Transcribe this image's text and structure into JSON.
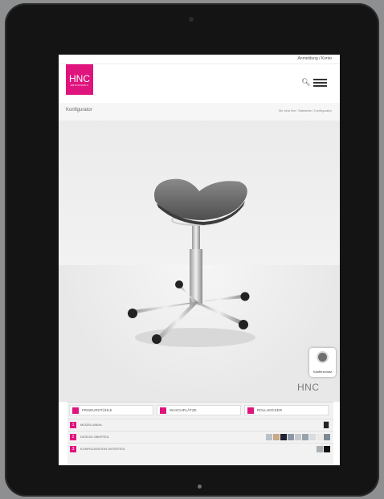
{
  "header": {
    "account_link": "Anmeldung / Konto",
    "logo_text": "HNC",
    "logo_subtext": "ERGONOMIC"
  },
  "subheader": {
    "page_title": "Konfigurator",
    "breadcrumb": "Sie sind hier: Startseite / Konfigurator"
  },
  "stage": {
    "badge_label": "Käuferschutz",
    "watermark_logo": "HNC"
  },
  "config": {
    "categories": [
      {
        "label": "FRISEURSTÜHLE"
      },
      {
        "label": "WASCHPLÄTZE"
      },
      {
        "label": "ROLLHOCKER"
      }
    ],
    "steps": [
      {
        "number": "1",
        "label": "MODELLWAHL"
      },
      {
        "number": "2",
        "label": "DESIGN OBERTEIL"
      },
      {
        "number": "3",
        "label": "KONFIGURATION UNTERTEIL"
      }
    ],
    "design_swatches": [
      "#b9c2c8",
      "#c9a98a",
      "#1f2330",
      "#8d98a6",
      "#c4c8cc",
      "#9aa3ad",
      "#d8dce0",
      "#eceae6",
      "#7e8a93"
    ],
    "frame_swatches": [
      "#a9b1b7",
      "#111111"
    ]
  },
  "colors": {
    "brand": "#e0147d",
    "tablet_frame": "#141414"
  }
}
